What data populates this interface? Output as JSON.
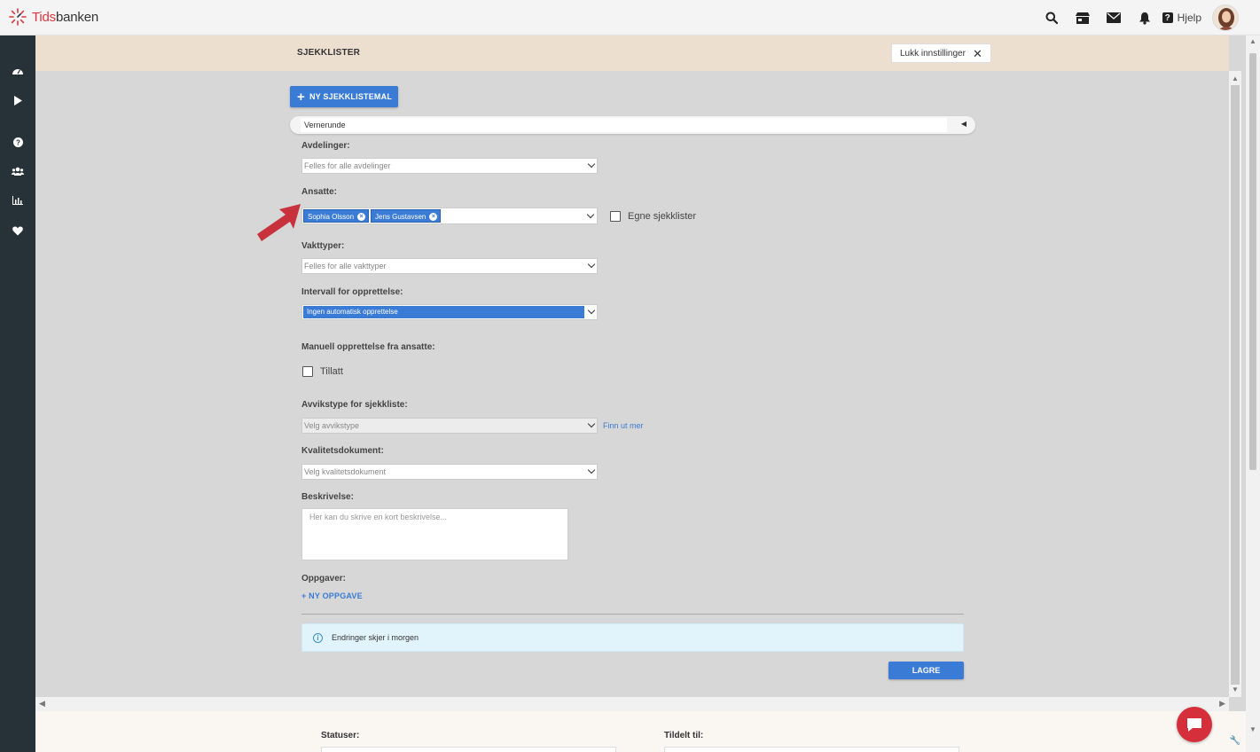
{
  "app": {
    "logo_part1": "Tids",
    "logo_part2": "banken",
    "help_label": "Hjelp"
  },
  "topbar_icons": [
    "search-icon",
    "store-icon",
    "mail-icon",
    "bell-icon",
    "help-icon"
  ],
  "sidebar_icons": [
    "dashboard-icon",
    "play-icon",
    "question-icon",
    "users-icon",
    "bar-chart-icon",
    "heart-icon"
  ],
  "header": {
    "title": "SJEKKLISTER",
    "close_label": "Lukk innstillinger",
    "close_x": "✕"
  },
  "form": {
    "new_template_label": "NY SJEKKLISTEMAL",
    "template_name": "Vernerunde",
    "departments_label": "Avdelinger:",
    "departments_value": "Felles for alle avdelinger",
    "employees_label": "Ansatte:",
    "employees_tags": [
      "Sophia Olsson",
      "Jens Gustavsen"
    ],
    "own_checklists_label": "Egne sjekklister",
    "shift_types_label": "Vakttyper:",
    "shift_types_value": "Felles for alle vakttyper",
    "interval_label": "Intervall for opprettelse:",
    "interval_value": "Ingen automatisk opprettelse",
    "manual_label": "Manuell opprettelse fra ansatte:",
    "manual_allowed_label": "Tillatt",
    "deviation_label": "Avvikstype for sjekkliste:",
    "deviation_value": "Velg avvikstype",
    "find_more_label": "Finn ut mer",
    "quality_doc_label": "Kvalitetsdokument:",
    "quality_doc_value": "Velg kvalitetsdokument",
    "description_label": "Beskrivelse:",
    "description_placeholder": "Her kan du skrive en kort beskrivelse...",
    "tasks_label": "Oppgaver:",
    "new_task_label": "+ NY OPPGAVE",
    "info_text": "Endringer skjer i morgen",
    "save_label": "LAGRE"
  },
  "bottom": {
    "statuses_label": "Statuser:",
    "assigned_label": "Tildelt til:"
  },
  "colors": {
    "accent": "#3a7bd5",
    "sidebar": "#273238",
    "header_band": "#ecdfd0",
    "brand_red": "#d42f3a",
    "info_bg": "#e2f4fb"
  }
}
